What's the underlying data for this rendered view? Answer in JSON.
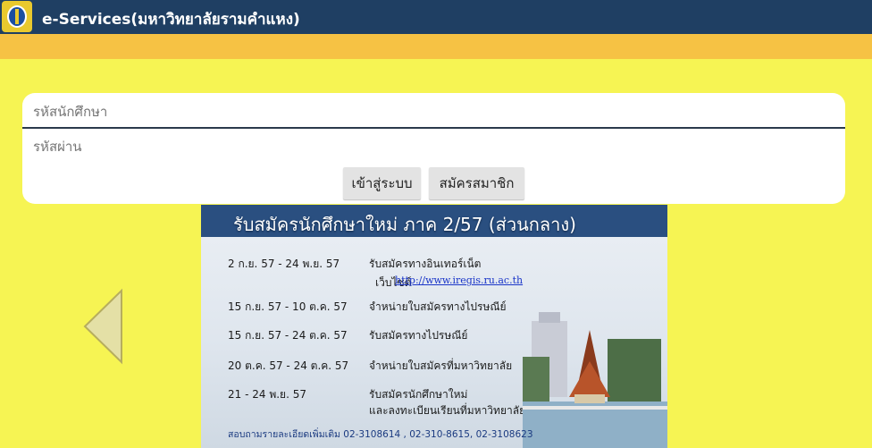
{
  "header": {
    "title": "e-Services(มหาวิทยาลัยรามคำแหง)",
    "accent": "#1f3f63",
    "band_color": "#f6c244",
    "background": "#f6f453"
  },
  "login": {
    "username_placeholder": "รหัสนักศึกษา",
    "password_placeholder": "รหัสผ่าน",
    "login_label": "เข้าสู่ระบบ",
    "register_label": "สมัครสมาชิก"
  },
  "banner": {
    "title": "รับสมัครนักศึกษาใหม่ ภาค 2/57  (ส่วนกลาง)",
    "rows": [
      {
        "date": "2 ก.ย. 57   -  24 พ.ย. 57",
        "text": "รับสมัครทางอินเทอร์เน็ต"
      },
      {
        "date": "15 ก.ย. 57 - 10 ต.ค. 57",
        "text": "จำหน่ายใบสมัครทางไปรษณีย์"
      },
      {
        "date": "15 ก.ย. 57 - 24 ต.ค. 57",
        "text": "รับสมัครทางไปรษณีย์"
      },
      {
        "date": "20 ต.ค. 57 - 24 ต.ค. 57",
        "text": "จำหน่ายใบสมัครที่มหาวิทยาลัย"
      },
      {
        "date": "21 - 24 พ.ย. 57",
        "text": "รับสมัครนักศึกษาใหม่"
      }
    ],
    "web_label": "เว็บไซต์",
    "web_url": "http://www.iregis.ru.ac.th",
    "row5_extra": "และลงทะเบียนเรียนที่มหาวิทยาลัย",
    "contact": "สอบถามรายละเอียดเพิ่มเติม  02-3108614 ,  02-310-8615,  02-3108623"
  },
  "nav": {
    "prev_icon": "left-triangle-arrow-icon"
  }
}
